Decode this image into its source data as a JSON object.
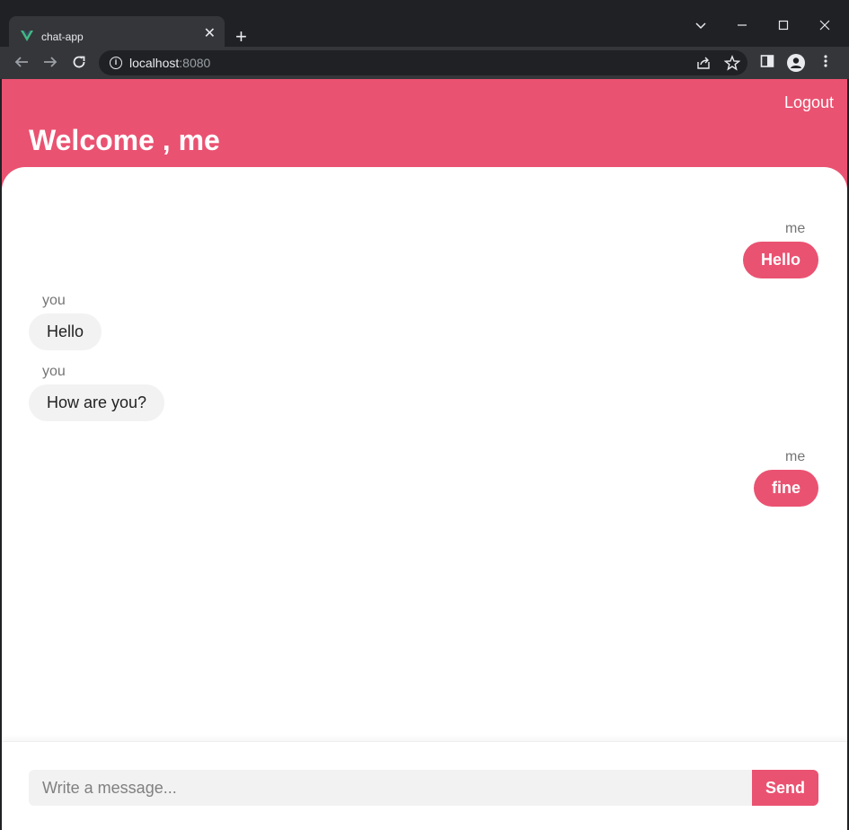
{
  "browser": {
    "tab_title": "chat-app",
    "tab_close": "✕",
    "new_tab": "+",
    "url_host": "localhost",
    "url_port": ":8080"
  },
  "header": {
    "logout_label": "Logout",
    "welcome_text": "Welcome , me"
  },
  "messages": [
    {
      "sender": "me",
      "text": "Hello",
      "side": "right"
    },
    {
      "sender": "you",
      "text": "Hello",
      "side": "left"
    },
    {
      "sender": "you",
      "text": "How are you?",
      "side": "left"
    },
    {
      "sender": "me",
      "text": "fine",
      "side": "right"
    }
  ],
  "composer": {
    "placeholder": "Write a message...",
    "value": "",
    "send_label": "Send"
  },
  "colors": {
    "accent": "#ea5271",
    "bubble_incoming": "#f2f2f2"
  }
}
